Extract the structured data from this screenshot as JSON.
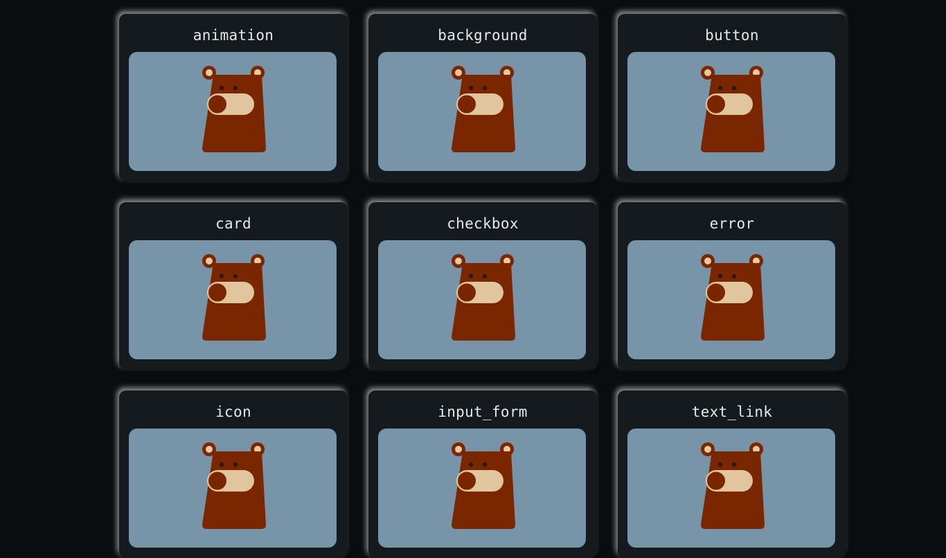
{
  "cards": [
    {
      "title": "animation"
    },
    {
      "title": "background"
    },
    {
      "title": "button"
    },
    {
      "title": "card"
    },
    {
      "title": "checkbox"
    },
    {
      "title": "error"
    },
    {
      "title": "icon"
    },
    {
      "title": "input_form"
    },
    {
      "title": "text_link"
    }
  ],
  "colors": {
    "page_background": "#0a0d10",
    "card_background": "#141a1e",
    "preview_background": "#7894a8",
    "bear_body": "#7a2600",
    "bear_ear_inner": "#e8c9a0",
    "bear_snout": "#e0c59e",
    "bear_eye": "#2a1a14",
    "title_text": "#e6e9ec"
  },
  "icons": {
    "preview_illustration": "bear-toggle-icon"
  }
}
